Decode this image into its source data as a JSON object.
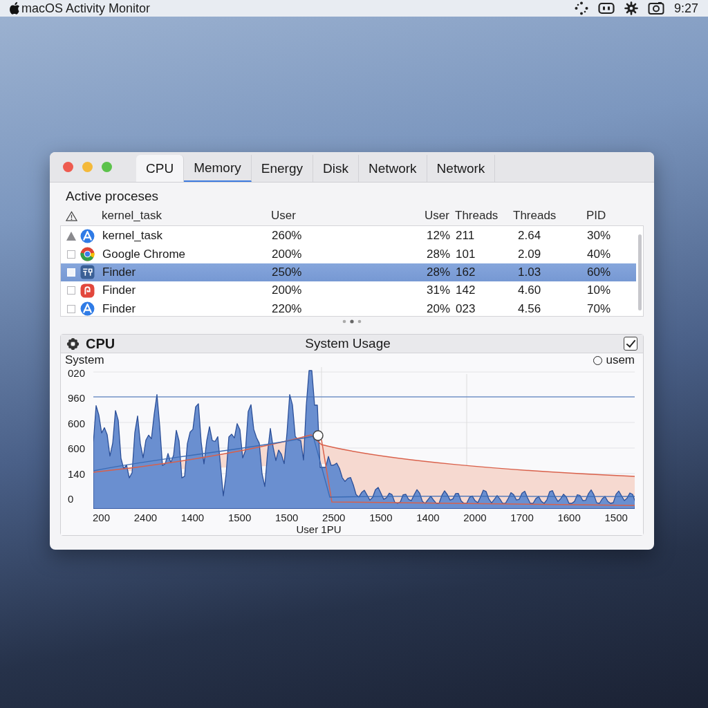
{
  "menu_bar": {
    "title": "macOS Activity Monitor",
    "time": "9:27"
  },
  "window": {
    "tabs": [
      {
        "label": "CPU",
        "selected": true,
        "focused": false
      },
      {
        "label": "Memory",
        "selected": false,
        "focused": true
      },
      {
        "label": "Energy",
        "selected": false,
        "focused": false
      },
      {
        "label": "Disk",
        "selected": false,
        "focused": false
      },
      {
        "label": "Network",
        "selected": false,
        "focused": false
      },
      {
        "label": "Network",
        "selected": false,
        "focused": false
      }
    ],
    "section_title": "Active proceses",
    "table": {
      "columns": [
        "kernel_task",
        "User",
        "User",
        "Threads",
        "Threads",
        "PID"
      ],
      "rows": [
        {
          "kind": "appstore",
          "expanded": true,
          "selected": false,
          "cells": [
            "kernel_task",
            "260%",
            "12%",
            "211",
            "2.64",
            "30%"
          ]
        },
        {
          "kind": "chrome",
          "expanded": false,
          "selected": false,
          "cells": [
            "Google Chrome",
            "200%",
            "28%",
            "101",
            "2.09",
            "40%"
          ]
        },
        {
          "kind": "finder",
          "expanded": false,
          "selected": true,
          "cells": [
            "Finder",
            "250%",
            "28%",
            "162",
            "1.03",
            "60%"
          ]
        },
        {
          "kind": "red-app",
          "expanded": false,
          "selected": false,
          "cells": [
            "Finder",
            "200%",
            "31%",
            "142",
            "4.60",
            "10%"
          ]
        },
        {
          "kind": "appstore",
          "expanded": false,
          "selected": false,
          "cells": [
            "Finder",
            "220%",
            "20%",
            "023",
            "4.56",
            "70%"
          ]
        }
      ]
    },
    "chart_panel": {
      "title": "CPU",
      "subtitle": "System Usage",
      "checked": true,
      "y_title": "System",
      "legend": "usem",
      "y_tick_labels": [
        "020",
        "960",
        "600",
        "600",
        "140",
        "0"
      ],
      "x_tick_labels": [
        "200",
        "2400",
        "1400",
        "1500",
        "1500",
        "2500",
        "1500",
        "1400",
        "2000",
        "1700",
        "1600",
        "1500"
      ],
      "xlabel": "User 1PU"
    }
  }
}
